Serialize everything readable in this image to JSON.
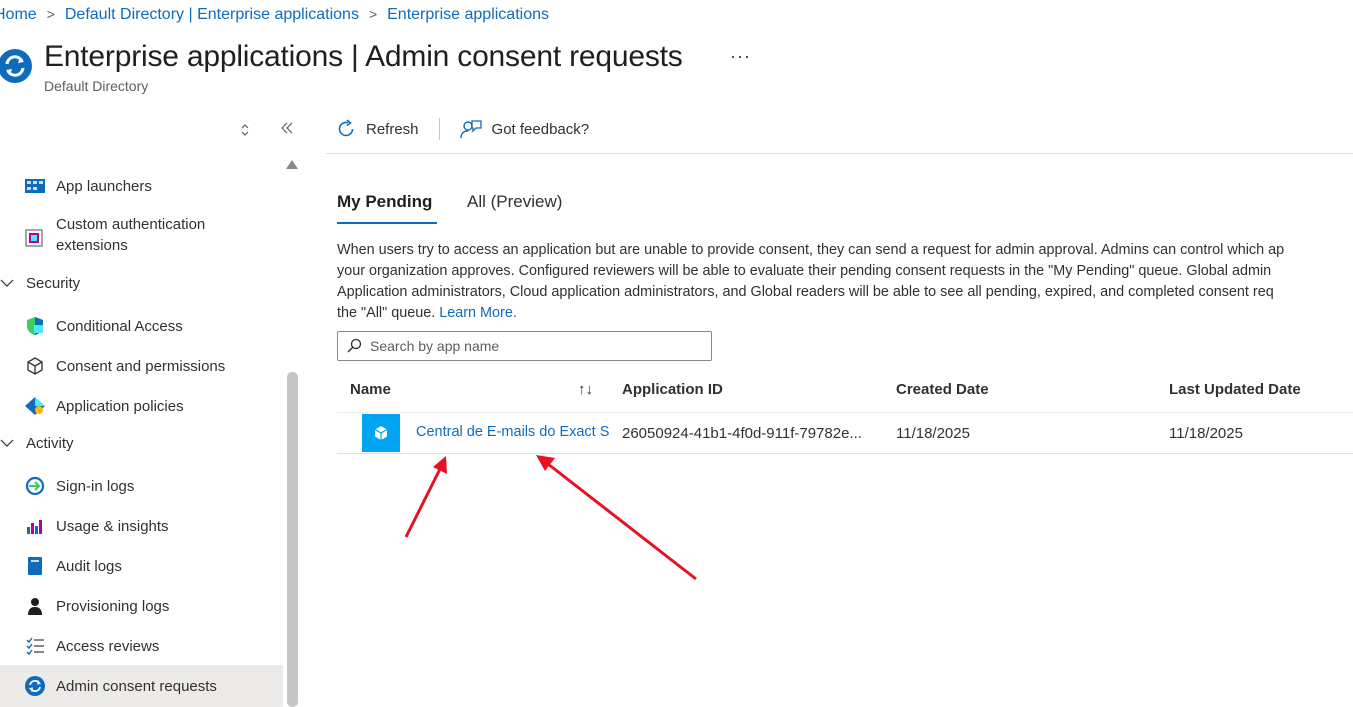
{
  "breadcrumb": {
    "items": [
      "Home",
      "Default Directory | Enterprise applications",
      "Enterprise applications"
    ]
  },
  "header": {
    "title": "Enterprise applications | Admin consent requests",
    "subtitle": "Default Directory",
    "more": "···"
  },
  "sidebar": {
    "items": [
      {
        "label": "App launchers"
      },
      {
        "label": "Custom authentication extensions"
      },
      {
        "label": "Conditional Access"
      },
      {
        "label": "Consent and permissions"
      },
      {
        "label": "Application policies"
      },
      {
        "label": "Sign-in logs"
      },
      {
        "label": "Usage & insights"
      },
      {
        "label": "Audit logs"
      },
      {
        "label": "Provisioning logs"
      },
      {
        "label": "Access reviews"
      },
      {
        "label": "Admin consent requests"
      }
    ],
    "groups": [
      {
        "label": "Security"
      },
      {
        "label": "Activity"
      }
    ],
    "selected": "Admin consent requests"
  },
  "toolbar": {
    "refresh": "Refresh",
    "feedback": "Got feedback?"
  },
  "tabs": [
    "My Pending",
    "All (Preview)"
  ],
  "description": {
    "line1": "When users try to access an application but are unable to provide consent, they can send a request for admin approval. Admins can control which ap",
    "line2": "your organization approves. Configured reviewers will be able to evaluate their pending consent requests in the \"My Pending\" queue. Global admin",
    "line3": "Application administrators, Cloud application administrators, and Global readers will be able to see all pending, expired, and completed consent req",
    "line4": "the \"All\" queue.",
    "link": "Learn More."
  },
  "search": {
    "placeholder": "Search by app name"
  },
  "table": {
    "headers": [
      "Name",
      "Application ID",
      "Created Date",
      "Last Updated Date"
    ],
    "sort_icon": "↑↓",
    "rows": [
      {
        "name": "Central de E-mails do Exact Spotter",
        "application_id": "26050924-41b1-4f0d-911f-79782e...",
        "created": "11/18/2025",
        "updated": "11/18/2025"
      }
    ]
  },
  "colors": {
    "accent": "#0f6cbd",
    "annotation": "#e81123",
    "app_icon": "#00a4ef"
  }
}
